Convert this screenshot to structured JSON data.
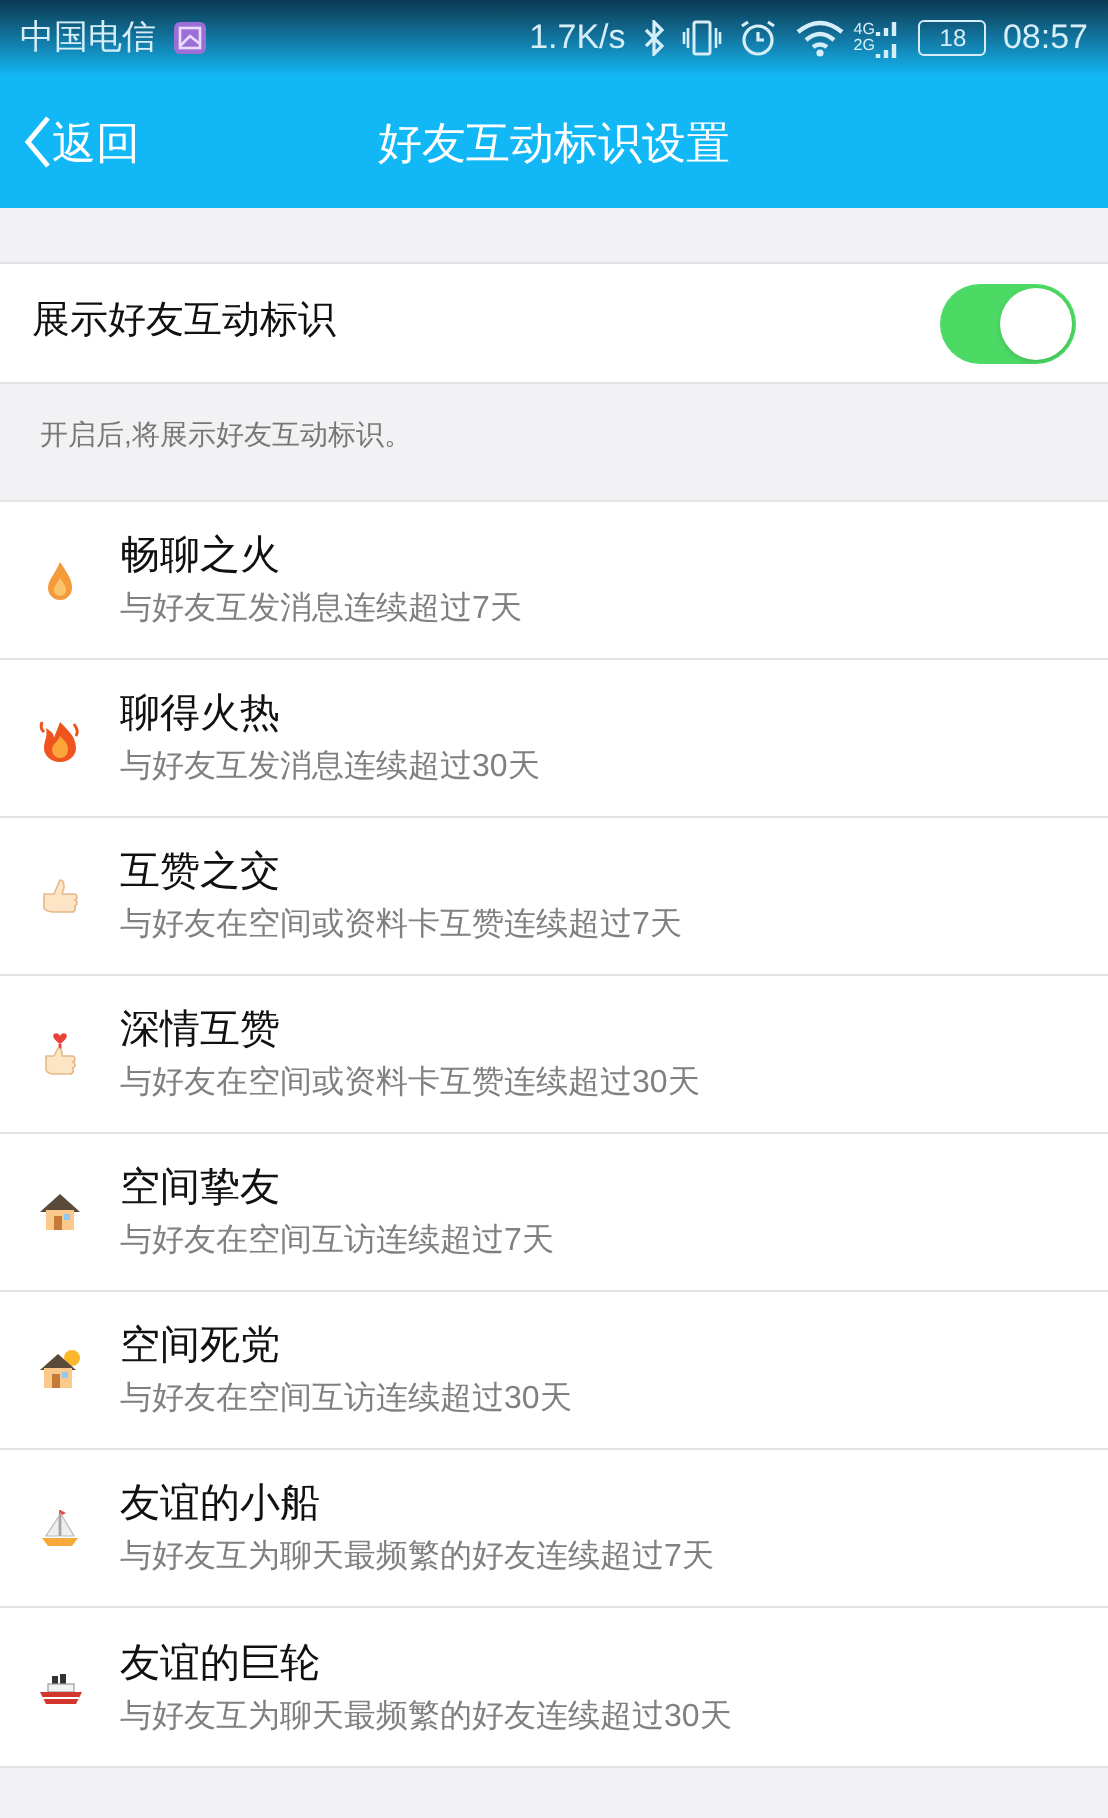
{
  "status_bar": {
    "carrier": "中国电信",
    "speed": "1.7K/s",
    "network_labels": [
      "4G",
      "2G"
    ],
    "battery": "18",
    "time": "08:57"
  },
  "nav": {
    "back": "返回",
    "title": "好友互动标识设置"
  },
  "toggle": {
    "label": "展示好友互动标识",
    "on": true
  },
  "hint": "开启后,将展示好友互动标识。",
  "items": [
    {
      "kind": "flame",
      "title": "畅聊之火",
      "desc": "与好友互发消息连续超过7天"
    },
    {
      "kind": "big-flame",
      "title": "聊得火热",
      "desc": "与好友互发消息连续超过30天"
    },
    {
      "kind": "thumb",
      "title": "互赞之交",
      "desc": "与好友在空间或资料卡互赞连续超过7天"
    },
    {
      "kind": "thumb-heart",
      "title": "深情互赞",
      "desc": "与好友在空间或资料卡互赞连续超过30天"
    },
    {
      "kind": "house",
      "title": "空间挚友",
      "desc": "与好友在空间互访连续超过7天"
    },
    {
      "kind": "house-sun",
      "title": "空间死党",
      "desc": "与好友在空间互访连续超过30天"
    },
    {
      "kind": "sailboat",
      "title": "友谊的小船",
      "desc": "与好友互为聊天最频繁的好友连续超过7天"
    },
    {
      "kind": "ship",
      "title": "友谊的巨轮",
      "desc": "与好友互为聊天最频繁的好友连续超过30天"
    }
  ]
}
